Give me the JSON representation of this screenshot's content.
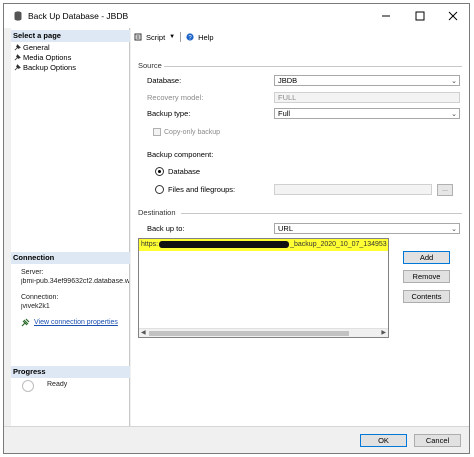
{
  "window": {
    "title": "Back Up Database - JBDB"
  },
  "left_pane": {
    "select_page_header": "Select a page",
    "pages": [
      "General",
      "Media Options",
      "Backup Options"
    ],
    "connection_header": "Connection",
    "server_label": "Server:",
    "server_value": "jbmi-pub.34ef99632cf2.database.w",
    "connection_label": "Connection:",
    "connection_value": "jvivek2k1",
    "view_connection_link": "View connection properties",
    "progress_header": "Progress",
    "progress_status": "Ready"
  },
  "toolbar": {
    "script_label": "Script",
    "help_label": "Help"
  },
  "source": {
    "group_label": "Source",
    "database_label": "Database:",
    "database_value": "JBDB",
    "recovery_model_label": "Recovery model:",
    "recovery_model_value": "FULL",
    "backup_type_label": "Backup type:",
    "backup_type_value": "Full",
    "copy_only_label": "Copy-only backup",
    "backup_component_label": "Backup component:",
    "database_option": "Database",
    "files_option": "Files and filegroups:",
    "browse_label": "..."
  },
  "destination": {
    "group_label": "Destination",
    "back_up_to_label": "Back up to:",
    "back_up_to_value": "URL",
    "entry_prefix": "https:",
    "entry_suffix": "_backup_2020_10_07_134953",
    "add_label": "Add",
    "remove_label": "Remove",
    "contents_label": "Contents"
  },
  "footer": {
    "ok_label": "OK",
    "cancel_label": "Cancel"
  },
  "colors": {
    "section_header_bg": "#dde8f4",
    "highlight": "#ffff33",
    "link": "#1a4fb0"
  }
}
